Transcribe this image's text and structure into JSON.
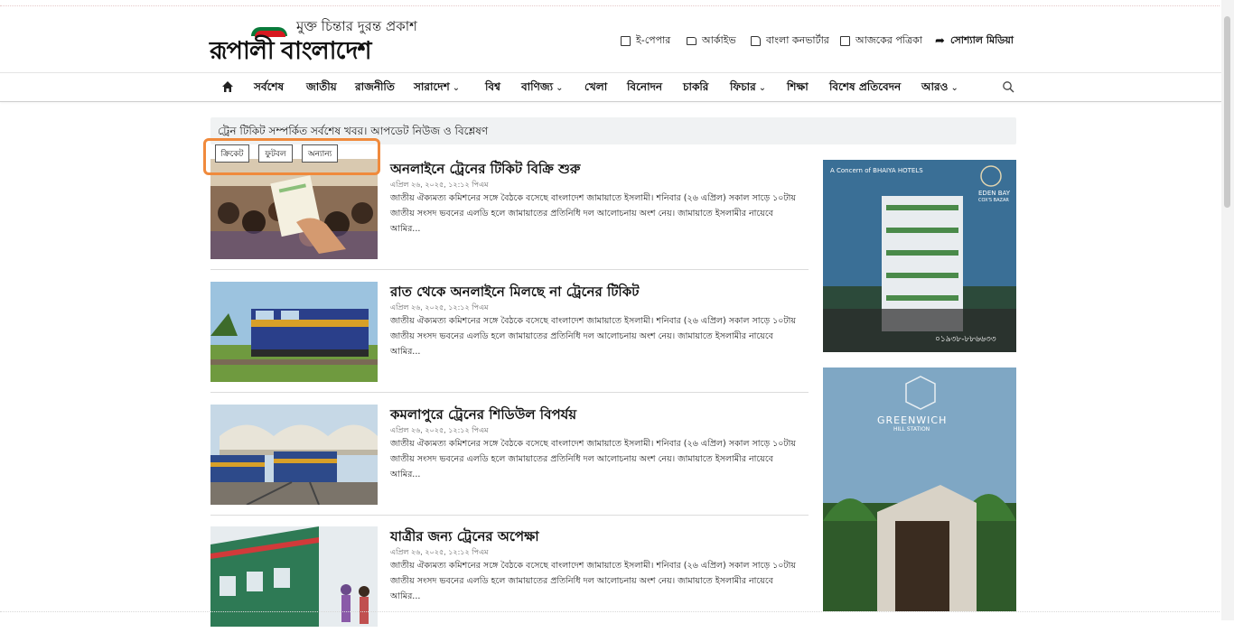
{
  "header": {
    "logo_tagline": "মুক্ত চিন্তার দুরন্ত প্রকাশ",
    "logo_name": "রূপালী বাংলাদেশ",
    "utility_links": [
      {
        "label": "ই-পেপার",
        "icon": "newspaper-icon"
      },
      {
        "label": "আর্কাইভ",
        "icon": "folder-icon"
      },
      {
        "label": "বাংলা কনভার্টার",
        "icon": "document-icon"
      },
      {
        "label": "আজকের পত্রিকা",
        "icon": "news-icon"
      },
      {
        "label": "সোশ্যাল মিডিয়া",
        "icon": "share-arrow-icon"
      }
    ]
  },
  "nav": {
    "items": [
      "সর্বশেষ",
      "জাতীয়",
      "রাজনীতি",
      "সারাদেশ",
      "বিশ্ব",
      "বাণিজ্য",
      "খেলা",
      "বিনোদন",
      "চাকরি",
      "ফিচার",
      "শিক্ষা",
      "বিশেষ প্রতিবেদন",
      "আরও"
    ]
  },
  "topic": {
    "title": "ট্রেন টিকিট সম্পর্কিত সর্বশেষ খবর। আপডেট নিউজ ও বিশ্লেষণ"
  },
  "chips": [
    "ক্রিকেট",
    "ফুটবল",
    "অন্যান্য"
  ],
  "articles": [
    {
      "title": "অনলাইনে ট্রেনের টিকিট বিক্রি শুরু",
      "date": "এপ্রিল ২৬, ২০২৫, ১২:১২ পিএম",
      "excerpt": "জাতীয় ঐক্যমত্য কমিশনের সঙ্গে বৈঠকে বসেছে বাংলাদেশ জামায়াতে ইসলামী। শনিবার (২৬ এপ্রিল) সকাল সাড়ে ১০টায় জাতীয় সংসদ ভবনের এলডি হলে জামায়াতের প্রতিনিধি দল আলোচনায় অংশ নেয়। জামায়াতে ইসলামীর নায়েবে আমির..."
    },
    {
      "title": "রাত থেকে অনলাইনে মিলছে না ট্রেনের টিকিট",
      "date": "এপ্রিল ২৬, ২০২৫, ১২:১২ পিএম",
      "excerpt": "জাতীয় ঐক্যমত্য কমিশনের সঙ্গে বৈঠকে বসেছে বাংলাদেশ জামায়াতে ইসলামী। শনিবার (২৬ এপ্রিল) সকাল সাড়ে ১০টায় জাতীয় সংসদ ভবনের এলডি হলে জামায়াতের প্রতিনিধি দল আলোচনায় অংশ নেয়। জামায়াতে ইসলামীর নায়েবে আমির..."
    },
    {
      "title": "কমলাপুরে ট্রেনের শিডিউল বিপর্যয়",
      "date": "এপ্রিল ২৬, ২০২৫, ১২:১২ পিএম",
      "excerpt": "জাতীয় ঐক্যমত্য কমিশনের সঙ্গে বৈঠকে বসেছে বাংলাদেশ জামায়াতে ইসলামী। শনিবার (২৬ এপ্রিল) সকাল সাড়ে ১০টায় জাতীয় সংসদ ভবনের এলডি হলে জামায়াতের প্রতিনিধি দল আলোচনায় অংশ নেয়। জামায়াতে ইসলামীর নায়েবে আমির..."
    },
    {
      "title": "যাত্রীর জন্য ট্রেনের অপেক্ষা",
      "date": "এপ্রিল ২৬, ২০২৫, ১২:১২ পিএম",
      "excerpt": "জাতীয় ঐক্যমত্য কমিশনের সঙ্গে বৈঠকে বসেছে বাংলাদেশ জামায়াতে ইসলামী। শনিবার (২৬ এপ্রিল) সকাল সাড়ে ১০টায় জাতীয় সংসদ ভবনের এলডি হলে জামায়াতের প্রতিনিধি দল আলোচনায় অংশ নেয়। জামায়াতে ইসলামীর নায়েবে আমির..."
    }
  ],
  "ads": {
    "ad1": {
      "brand_top": "A Concern of BHAIYA HOTELS",
      "brand_right": "EDEN BAY",
      "brand_right_sub": "COX'S BAZAR",
      "phone": "০১৯৩৮-৮৮৬৬৩৩"
    },
    "ad2": {
      "brand": "GREENWICH",
      "brand_sub": "HILL STATION"
    }
  },
  "colors": {
    "accent_highlight": "#f08a3c",
    "logo_green": "#0a7a3a",
    "logo_red": "#d71920"
  }
}
